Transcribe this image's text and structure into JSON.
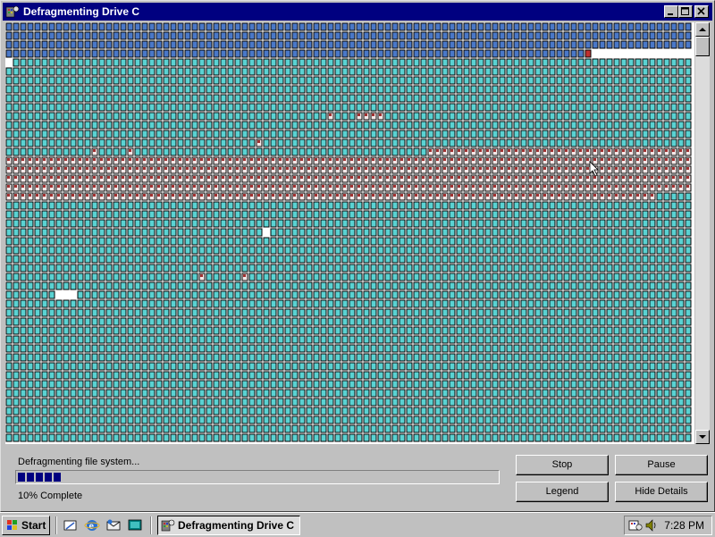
{
  "window": {
    "title": "Defragmenting Drive C"
  },
  "cluster_map": {
    "legend_colors": {
      "optimized": "#5ad2d2",
      "fragmented": "#a03030",
      "defragging_marker": "#c03030",
      "empty": "#ffffff",
      "system": "#4a78c8"
    }
  },
  "status": {
    "message": "Defragmenting file system...",
    "percent_text": "10% Complete",
    "progress_percent": 10
  },
  "buttons": {
    "stop": "Stop",
    "pause": "Pause",
    "legend": "Legend",
    "hide_details": "Hide Details"
  },
  "taskbar": {
    "start_label": "Start",
    "task_label": "Defragmenting Drive C",
    "clock": "7:28 PM"
  }
}
